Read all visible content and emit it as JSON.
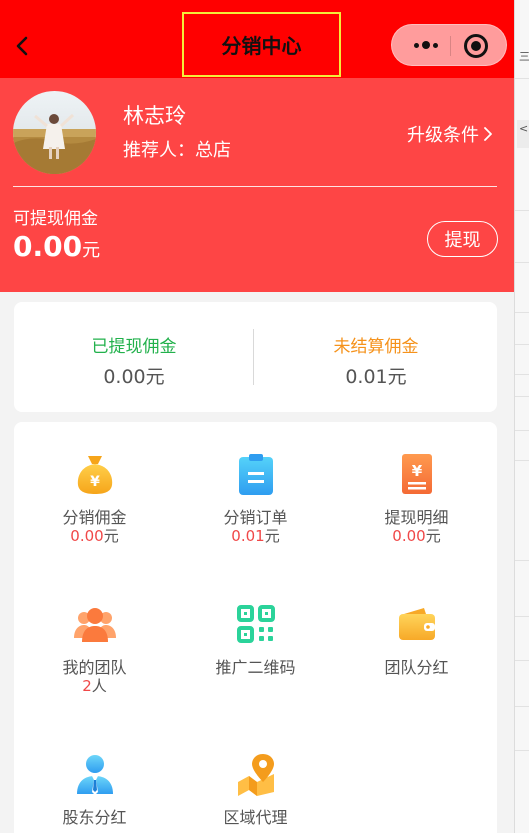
{
  "nav": {
    "title": "分销中心"
  },
  "profile": {
    "name": "林志玲",
    "referrer": "推荐人：总店",
    "upgrade_label": "升级条件"
  },
  "balance": {
    "label": "可提现佣金",
    "value": "0.00",
    "unit": "元",
    "withdraw_label": "提现"
  },
  "summary": {
    "withdrawn_label": "已提现佣金",
    "withdrawn_value": "0.00元",
    "unsettled_label": "未结算佣金",
    "unsettled_value": "0.01元"
  },
  "menu": [
    {
      "label": "分销佣金",
      "sub_num": "0.00",
      "sub_unit": "元",
      "icon": "money-bag-icon"
    },
    {
      "label": "分销订单",
      "sub_num": "0.01",
      "sub_unit": "元",
      "icon": "clipboard-icon"
    },
    {
      "label": "提现明细",
      "sub_num": "0.00",
      "sub_unit": "元",
      "icon": "yuan-receipt-icon"
    },
    {
      "label": "我的团队",
      "sub_num": "2",
      "sub_unit": "人",
      "icon": "team-icon"
    },
    {
      "label": "推广二维码",
      "icon": "qr-code-icon"
    },
    {
      "label": "团队分红",
      "icon": "wallet-icon"
    },
    {
      "label": "股东分红",
      "icon": "shareholder-icon"
    },
    {
      "label": "区域代理",
      "icon": "map-pin-icon"
    }
  ],
  "colors": {
    "navbar": "#ff0000",
    "header": "#fe4545",
    "withdrawn_green": "#22b14c",
    "unsettled_orange": "#f5921b",
    "highlight_red": "#f04848"
  }
}
